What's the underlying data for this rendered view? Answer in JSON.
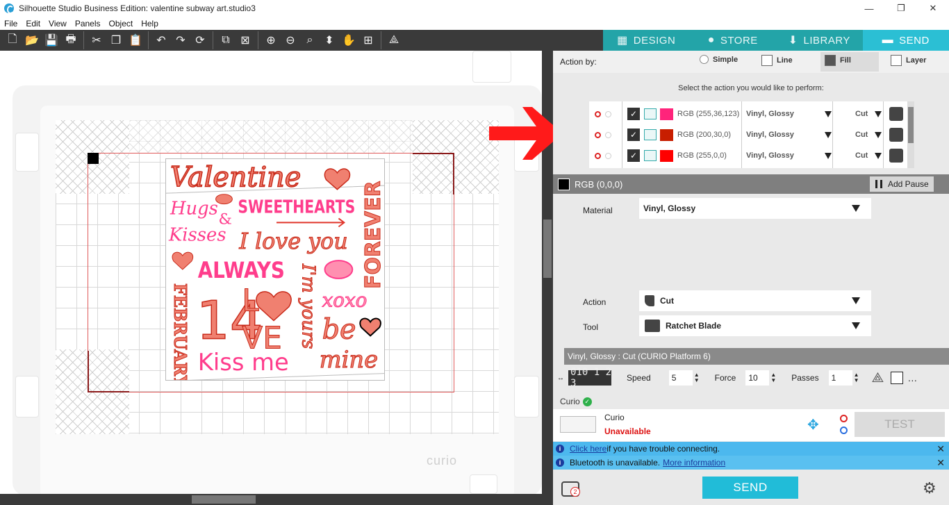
{
  "window": {
    "title": "Silhouette Studio Business Edition: valentine subway art.studio3",
    "minimize": "—",
    "maximize": "❐",
    "close": "✕"
  },
  "menu": [
    "File",
    "Edit",
    "View",
    "Panels",
    "Object",
    "Help"
  ],
  "toolbar_icons": [
    "new-icon",
    "open-icon",
    "save-icon",
    "print-icon",
    "cut-icon",
    "copy-icon",
    "paste-icon",
    "undo-icon",
    "redo-icon",
    "redraw-icon",
    "group-icon",
    "ungroup-icon",
    "zoom-in-icon",
    "zoom-out-icon",
    "zoom-select-icon",
    "pan-up-icon",
    "hand-icon",
    "fit-icon",
    "trace-icon"
  ],
  "tabs": [
    {
      "label": "DESIGN",
      "icon": "grid-icon",
      "active": false
    },
    {
      "label": "STORE",
      "icon": "store-icon",
      "active": false
    },
    {
      "label": "LIBRARY",
      "icon": "library-icon",
      "active": false
    },
    {
      "label": "SEND",
      "icon": "send-icon",
      "active": true
    }
  ],
  "canvas": {
    "mat_brand": "curio",
    "artwork": {
      "valentine": "Valentine",
      "hugs": "Hugs",
      "amp": "&",
      "kisses": "Kisses",
      "sweethearts": "SWEETHEARTS",
      "iloveyou": "I love you",
      "forever": "FOREVER",
      "always": "ALWAYS",
      "imyours": "I'm yours",
      "february": "FEBRUARY",
      "fourteen": "14",
      "l": "L",
      "ve": "VE",
      "xoxo": "xoxo",
      "be": "be",
      "mine": "mine",
      "kissme": "Kiss me"
    }
  },
  "panel": {
    "action_by_label": "Action by:",
    "modes": [
      {
        "label": "Simple",
        "active": false
      },
      {
        "label": "Line",
        "active": false
      },
      {
        "label": "Fill",
        "active": true
      },
      {
        "label": "Layer",
        "active": false
      }
    ],
    "select_prompt": "Select the action you would like to perform:",
    "layers": [
      {
        "color": "#ff247b",
        "label": "RGB (255,36,123)",
        "material": "Vinyl, Glossy",
        "action": "Cut"
      },
      {
        "color": "#c81e00",
        "label": "RGB (200,30,0)",
        "material": "Vinyl, Glossy",
        "action": "Cut"
      },
      {
        "color": "#ff0000",
        "label": "RGB (255,0,0)",
        "material": "Vinyl, Glossy",
        "action": "Cut"
      }
    ],
    "selected": {
      "color": "#000000",
      "label": "RGB (0,0,0)"
    },
    "add_pause": "Add Pause",
    "material_label": "Material",
    "material_value": "Vinyl, Glossy",
    "action_label": "Action",
    "action_value": "Cut",
    "tool_label": "Tool",
    "tool_value": "Ratchet Blade",
    "profile": "Vinyl, Glossy : Cut (CURIO Platform 6)",
    "depth": "010 1 2 3",
    "speed_label": "Speed",
    "speed": "5",
    "force_label": "Force",
    "force": "10",
    "passes_label": "Passes",
    "passes": "1",
    "device_section": "Curio",
    "device_name": "Curio",
    "device_status": "Unavailable",
    "test": "TEST",
    "info1_link": "Click here",
    "info1_text": " if you have trouble connecting.",
    "info2_text": "Bluetooth is unavailable. ",
    "info2_link": "More information",
    "send": "SEND",
    "queue_count": "2"
  }
}
